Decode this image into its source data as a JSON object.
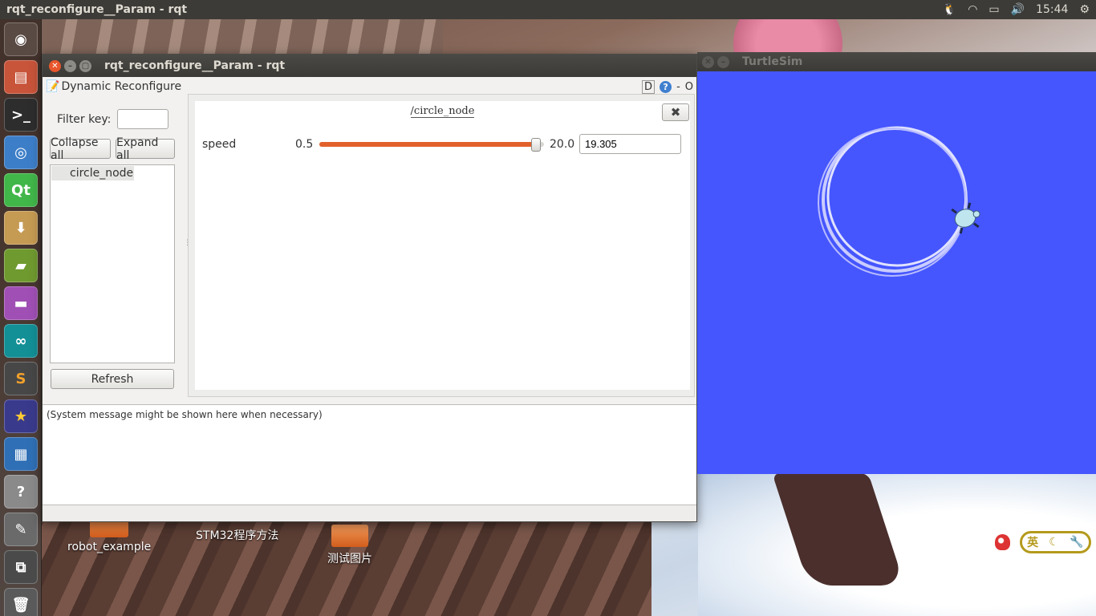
{
  "top_panel": {
    "title": "rqt_reconfigure__Param - rqt",
    "clock": "15:44"
  },
  "desktop": {
    "icons": [
      {
        "label": "robot_example"
      },
      {
        "label": "STM32程序方法"
      },
      {
        "label": "测试图片"
      }
    ]
  },
  "rqt_window": {
    "title": "rqt_reconfigure__Param - rqt",
    "plugin_name": "Dynamic Reconfigure",
    "plugin_controls": [
      "D",
      "?",
      "-",
      "O"
    ],
    "filter_label": "Filter key:",
    "filter_value": "",
    "collapse_label": "Collapse all",
    "expand_label": "Expand all",
    "tree_items": [
      "circle_node"
    ],
    "refresh_label": "Refresh",
    "node_title": "/circle_node",
    "close_node_glyph": "✖",
    "param": {
      "name": "speed",
      "min": "0.5",
      "max": "20.0",
      "value": "19.305",
      "fraction": 0.9637
    },
    "system_message": "(System message might be shown here when necessary)"
  },
  "turtlesim": {
    "title": "TurtleSim",
    "background": "#4556ff"
  },
  "ime": {
    "label": "英"
  },
  "colors": {
    "slider_fill": "#e2612b",
    "close_button": "#e9562c",
    "panel": "#3c3b37"
  }
}
